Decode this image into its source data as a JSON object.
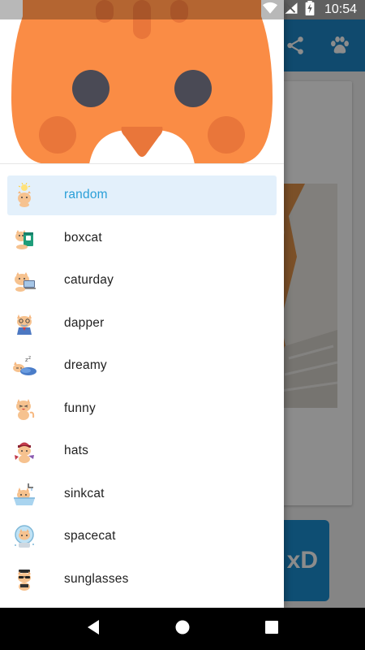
{
  "status_bar": {
    "time": "10:54"
  },
  "toolbar": {
    "share_icon": "share-icon",
    "paw_icon": "paw-icon"
  },
  "action_button": {
    "label": "xD"
  },
  "drawer": {
    "items": [
      {
        "label": "random",
        "icon": "lightbulb-cat-icon",
        "active": true
      },
      {
        "label": "boxcat",
        "icon": "box-cat-icon"
      },
      {
        "label": "caturday",
        "icon": "laptop-cat-icon"
      },
      {
        "label": "dapper",
        "icon": "dapper-cat-icon"
      },
      {
        "label": "dreamy",
        "icon": "sleeping-cat-icon"
      },
      {
        "label": "funny",
        "icon": "funny-cat-icon"
      },
      {
        "label": "hats",
        "icon": "hat-cat-icon"
      },
      {
        "label": "sinkcat",
        "icon": "sink-cat-icon"
      },
      {
        "label": "spacecat",
        "icon": "space-cat-icon"
      },
      {
        "label": "sunglasses",
        "icon": "sunglasses-cat-icon"
      }
    ]
  },
  "colors": {
    "toolbar": "#1e88c9",
    "accent": "#2a9fd8",
    "active_item_bg": "#e3f0fb",
    "cat_orange": "#fa8c45"
  }
}
